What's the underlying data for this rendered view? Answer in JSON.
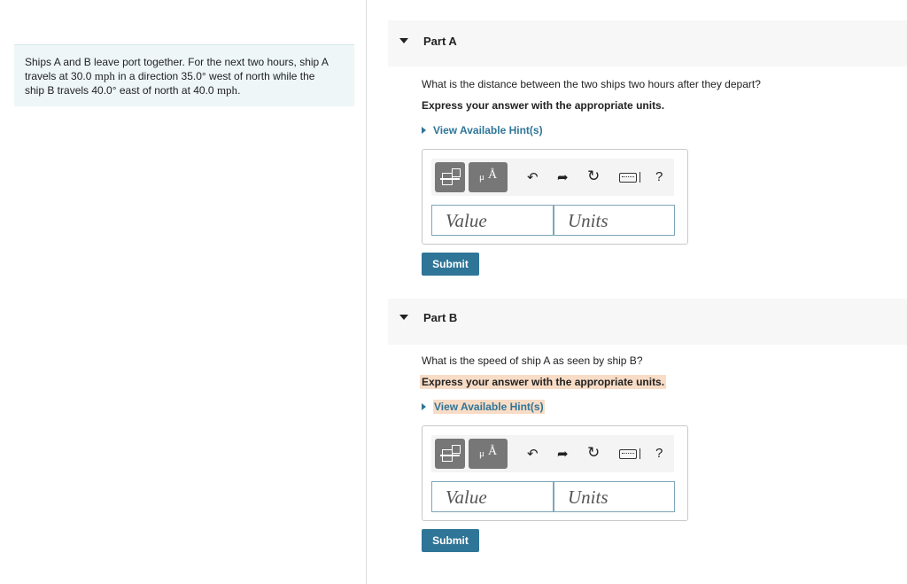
{
  "problem": {
    "t1": "Ships A and B leave port together. For the next two hours, ship A",
    "t2": "travels at 30.0 ",
    "u1": "mph",
    "t3": " in a direction 35.0° west of north while the",
    "t4": "ship B travels 40.0° east of north at 40.0 ",
    "u2": "mph",
    "t5": "."
  },
  "parts": [
    {
      "title": "Part A",
      "question": "What is the distance between the two ships two hours after they depart?",
      "instruction": "Express your answer with the appropriate units.",
      "hint": "View Available Hint(s)",
      "value_placeholder": "Value",
      "units_placeholder": "Units",
      "submit": "Submit"
    },
    {
      "title": "Part B",
      "question": "What is the speed of ship A as seen by ship B?",
      "instruction": "Express your answer with the appropriate units.",
      "hint": "View Available Hint(s)",
      "value_placeholder": "Value",
      "units_placeholder": "Units",
      "submit": "Submit"
    }
  ],
  "toolbar": {
    "mu_label": "μ",
    "angstrom_label": "Å",
    "undo_glyph": "↶",
    "redo_glyph": "➦",
    "reset_glyph": "↻",
    "help_label": "?",
    "icons": [
      "templates-icon",
      "units-icon",
      "undo-icon",
      "redo-icon",
      "reset-icon",
      "keyboard-icon",
      "help-icon"
    ]
  },
  "colors": {
    "accent": "#2f7598",
    "highlight": "#f8dcc6",
    "problem_bg": "#eef6f8"
  }
}
